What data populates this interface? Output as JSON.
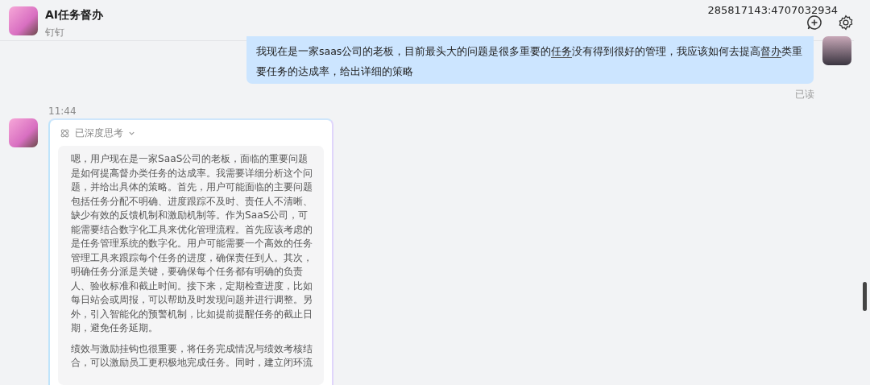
{
  "header": {
    "title": "AI任务督办",
    "subtitle": "钉钉",
    "session_id": "285817143:4707032934"
  },
  "messages": [
    {
      "kind": "user",
      "segments": [
        {
          "text": "我现在是一家saas公司的老板，目前最头大的问题是很多重要的",
          "underlined": false
        },
        {
          "text": "任务",
          "underlined": true
        },
        {
          "text": "没有得到很好的管理，我应该如何去提高",
          "underlined": false
        },
        {
          "text": "督办",
          "underlined": true
        },
        {
          "text": "类重要任务的达成率，给出详细的策略",
          "underlined": false
        }
      ],
      "receipt": "已读"
    },
    {
      "kind": "bot",
      "time": "11:44",
      "thinking": {
        "label": "已深度思考",
        "expanded": true,
        "paragraphs": [
          "嗯，用户现在是一家SaaS公司的老板，面临的重要问题是如何提高督办类任务的达成率。我需要详细分析这个问题，并给出具体的策略。首先，用户可能面临的主要问题包括任务分配不明确、进度跟踪不及时、责任人不清晰、缺少有效的反馈机制和激励机制等。作为SaaS公司，可能需要结合数字化工具来优化管理流程。首先应该考虑的是任务管理系统的数字化。用户可能需要一个高效的任务管理工具来跟踪每个任务的进度，确保责任到人。其次，明确任务分派是关键，要确保每个任务都有明确的负责人、验收标准和截止时间。接下来，定期检查进度，比如每日站会或周报，可以帮助及时发现问题并进行调整。另外，引入智能化的预警机制，比如提前提醒任务的截止日期，避免任务延期。",
          "绩效与激励挂钩也很重要，将任务完成情况与绩效考核结合，可以激励员工更积极地完成任务。同时，建立闭环流"
        ]
      }
    }
  ]
}
